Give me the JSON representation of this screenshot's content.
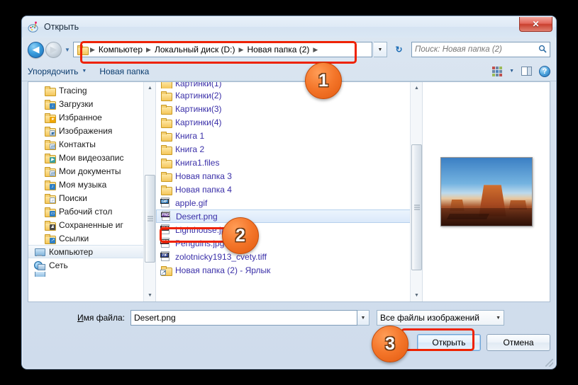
{
  "window": {
    "title": "Открыть",
    "app_icon": "paint-palette-icon",
    "close_label": "✕"
  },
  "nav": {
    "back_icon": "◀",
    "forward_icon": "▶",
    "history_caret": "▼",
    "refresh_icon": "↻",
    "address_caret": "▼",
    "breadcrumbs": [
      {
        "label": "Компьютер"
      },
      {
        "label": "Локальный диск (D:)"
      },
      {
        "label": "Новая папка (2)"
      }
    ],
    "separator": "▶",
    "search": {
      "placeholder": "Поиск: Новая папка (2)",
      "icon": "search-icon",
      "icon_glyph": "🔍"
    }
  },
  "toolbar": {
    "organize_label": "Упорядочить",
    "organize_caret": "▼",
    "new_folder_label": "Новая папка",
    "view_caret": "▼",
    "view_icon": "view-grid-icon",
    "preview_pane_icon": "preview-pane-icon",
    "help_label": "?"
  },
  "nav_pane": {
    "items": [
      {
        "label": "Tracing",
        "icon": "folder-icon",
        "overlay": "",
        "indent": true
      },
      {
        "label": "Загрузки",
        "icon": "folder-icon",
        "overlay": "blue",
        "overlay_glyph": "↓",
        "indent": true
      },
      {
        "label": "Избранное",
        "icon": "folder-icon",
        "overlay": "star",
        "overlay_glyph": "★",
        "indent": true
      },
      {
        "label": "Изображения",
        "icon": "folder-icon",
        "overlay": "white",
        "overlay_glyph": "▣",
        "indent": true
      },
      {
        "label": "Контакты",
        "icon": "folder-icon",
        "overlay": "white",
        "overlay_glyph": "▤",
        "indent": true
      },
      {
        "label": "Мои видеозапис",
        "icon": "folder-icon",
        "overlay": "teal",
        "overlay_glyph": "▶",
        "indent": true
      },
      {
        "label": "Мои документы",
        "icon": "folder-icon",
        "overlay": "white",
        "overlay_glyph": "▤",
        "indent": true
      },
      {
        "label": "Моя музыка",
        "icon": "folder-icon",
        "overlay": "blue",
        "overlay_glyph": "♪",
        "indent": true
      },
      {
        "label": "Поиски",
        "icon": "folder-icon",
        "overlay": "white",
        "overlay_glyph": "🔍",
        "indent": true
      },
      {
        "label": "Рабочий стол",
        "icon": "folder-icon",
        "overlay": "blue",
        "overlay_glyph": "▭",
        "indent": true
      },
      {
        "label": "Сохраненные иг",
        "icon": "folder-icon",
        "overlay": "dark",
        "overlay_glyph": "♟",
        "indent": true
      },
      {
        "label": "Ссылки",
        "icon": "folder-icon",
        "overlay": "blue",
        "overlay_glyph": "↗",
        "indent": true
      }
    ],
    "computer": {
      "label": "Компьютер",
      "icon": "computer-icon",
      "selected": true
    },
    "network": {
      "label": "Сеть",
      "icon": "network-icon"
    }
  },
  "file_list": {
    "clipped_top_label": "Картинки(1)",
    "items": [
      {
        "name": "Картинки(2)",
        "icon": "folder-icon",
        "type": "folder"
      },
      {
        "name": "Картинки(3)",
        "icon": "folder-icon",
        "type": "folder"
      },
      {
        "name": "Картинки(4)",
        "icon": "folder-icon",
        "type": "folder"
      },
      {
        "name": "Книга 1",
        "icon": "folder-icon",
        "type": "folder"
      },
      {
        "name": "Книга 2",
        "icon": "folder-icon",
        "type": "folder"
      },
      {
        "name": "Книга1.files",
        "icon": "folder-icon",
        "type": "folder"
      },
      {
        "name": "Новая папка 3",
        "icon": "folder-icon",
        "type": "folder"
      },
      {
        "name": "Новая папка 4",
        "icon": "folder-icon",
        "type": "folder"
      },
      {
        "name": "apple.gif",
        "icon": "gif-file-icon",
        "type": "gif",
        "tag": "GIF"
      },
      {
        "name": "Desert.png",
        "icon": "png-file-icon",
        "type": "png",
        "tag": "PNG",
        "selected": true
      },
      {
        "name": "Lighthouse.jpg",
        "icon": "jpg-file-icon",
        "type": "jpg",
        "tag": "JPG"
      },
      {
        "name": "Penguins.jpg",
        "icon": "jpg-file-icon",
        "type": "jpg",
        "tag": "JPG"
      },
      {
        "name": "zolotnicky1913_cvety.tiff",
        "icon": "tif-file-icon",
        "type": "tif",
        "tag": "TIF"
      },
      {
        "name": "Новая папка (2) - Ярлык",
        "icon": "folder-shortcut-icon",
        "type": "shortcut"
      }
    ]
  },
  "preview": {
    "alt": "Desert.png preview — desert butte at sunset"
  },
  "form": {
    "filename_label_prefix": "И",
    "filename_label_rest": "мя файла:",
    "filename_value": "Desert.png",
    "filename_caret": "▼",
    "filetype_value": "Все файлы изображений",
    "filetype_caret": "▼",
    "open_button": "Открыть",
    "cancel_button": "Отмена"
  },
  "annotations": {
    "badge1": "1",
    "badge2": "2",
    "badge3": "3",
    "highlight_color": "#ee2200",
    "badge_color": "#f4762a"
  },
  "scroll": {
    "up_arrow": "▲",
    "down_arrow": "▼"
  }
}
